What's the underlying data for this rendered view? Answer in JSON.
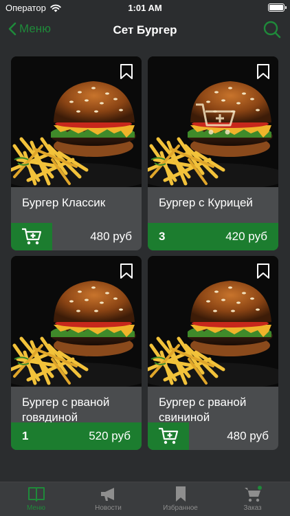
{
  "status_bar": {
    "carrier": "Оператор",
    "time": "1:01 AM"
  },
  "nav": {
    "back_label": "Меню",
    "title": "Сет Бургер"
  },
  "products": [
    {
      "name": "Бургер Классик",
      "price": "480 руб",
      "in_cart": false,
      "qty": ""
    },
    {
      "name": "Бургер с Курицей",
      "price": "420 руб",
      "in_cart": true,
      "qty": "3"
    },
    {
      "name": "Бургер с рваной говядиной",
      "price": "520 руб",
      "in_cart": true,
      "qty": "1"
    },
    {
      "name": "Бургер с рваной свининой",
      "price": "480 руб",
      "in_cart": false,
      "qty": ""
    }
  ],
  "tabs": [
    {
      "label": "Меню",
      "icon": "book-icon",
      "active": true
    },
    {
      "label": "Новости",
      "icon": "megaphone-icon",
      "active": false
    },
    {
      "label": "Избранное",
      "icon": "bookmark-icon",
      "active": false
    },
    {
      "label": "Заказ",
      "icon": "cart-icon",
      "active": false
    }
  ],
  "colors": {
    "accent": "#1f8a3a",
    "cart_button": "#1c7d2f",
    "background": "#2b2d2f",
    "card": "#4a4c4e"
  }
}
